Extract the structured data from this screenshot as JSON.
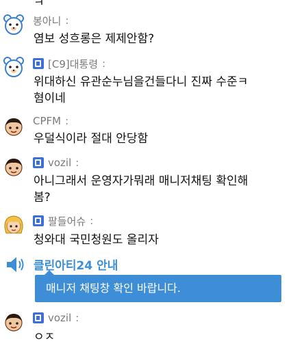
{
  "top_cut_text": "ㅋ",
  "messages": [
    {
      "user": "봉아니",
      "has_badge": false,
      "avatar": "bear-avatar",
      "lines": [
        "염보 성흐롱은 제제안함?"
      ]
    },
    {
      "user": "[C9]대통령",
      "has_badge": true,
      "avatar": "bear-avatar",
      "lines": [
        "위대하신 유관순누님을건들다니 진짜 수준ㅋ",
        "혐이네"
      ]
    },
    {
      "user": "CPFM",
      "has_badge": false,
      "avatar": "boy-avatar",
      "lines": [
        "우덜식이라 절대 안당함"
      ]
    },
    {
      "user": "vozil",
      "has_badge": true,
      "avatar": "boy-avatar",
      "lines": [
        "아니그래서 운영자가뭐래 매니저채팅 확인해",
        "봄?"
      ]
    },
    {
      "user": "팔들어슈",
      "has_badge": true,
      "avatar": "girl-avatar",
      "lines": [
        "청와대 국민청원도 올리자"
      ]
    },
    {
      "user": "vozil",
      "has_badge": true,
      "avatar": "boy-avatar",
      "lines": [
        "ㅇㅈ"
      ]
    }
  ],
  "separator": ":",
  "notice": {
    "title": "클린아티24 안내",
    "message": "매니저 채팅창 확인 바랍니다.",
    "icon": "speaker-icon"
  },
  "colors": {
    "accent": "#3d8ed6",
    "badge": "#3c6fd8",
    "username": "#7a7a7a"
  }
}
